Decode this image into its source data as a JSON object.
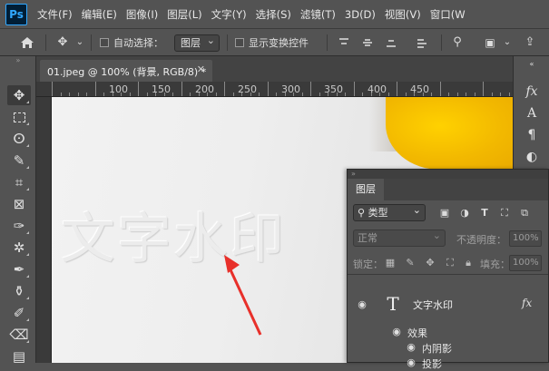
{
  "app": {
    "logo": "Ps"
  },
  "menu": [
    "文件(F)",
    "编辑(E)",
    "图像(I)",
    "图层(L)",
    "文字(Y)",
    "选择(S)",
    "滤镜(T)",
    "3D(D)",
    "视图(V)",
    "窗口(W"
  ],
  "options": {
    "auto_select_label": "自动选择：",
    "auto_select_value": "图层",
    "show_transform_label": "显示变换控件"
  },
  "document": {
    "tab_title": "01.jpeg @ 100% (背景, RGB/8) *",
    "watermark_text": "文字水印"
  },
  "ruler": {
    "labels": [
      "100",
      "150",
      "200",
      "250",
      "300",
      "350",
      "400",
      "450"
    ]
  },
  "layers_panel": {
    "tab_label": "图层",
    "filter_label": "类型",
    "blend_mode": "正常",
    "opacity_label": "不透明度：",
    "opacity_value": "100%",
    "lock_label": "锁定：",
    "fill_label": "填充：",
    "fill_value": "100%",
    "layer": {
      "name": "文字水印",
      "thumb": "T",
      "fx": "fx"
    },
    "effects_label": "效果",
    "effects": [
      "内阴影",
      "投影"
    ]
  },
  "colors": {
    "accent": "#31a8ff",
    "annotation_arrow": "#e8302a",
    "yellow": "#f5c000"
  }
}
